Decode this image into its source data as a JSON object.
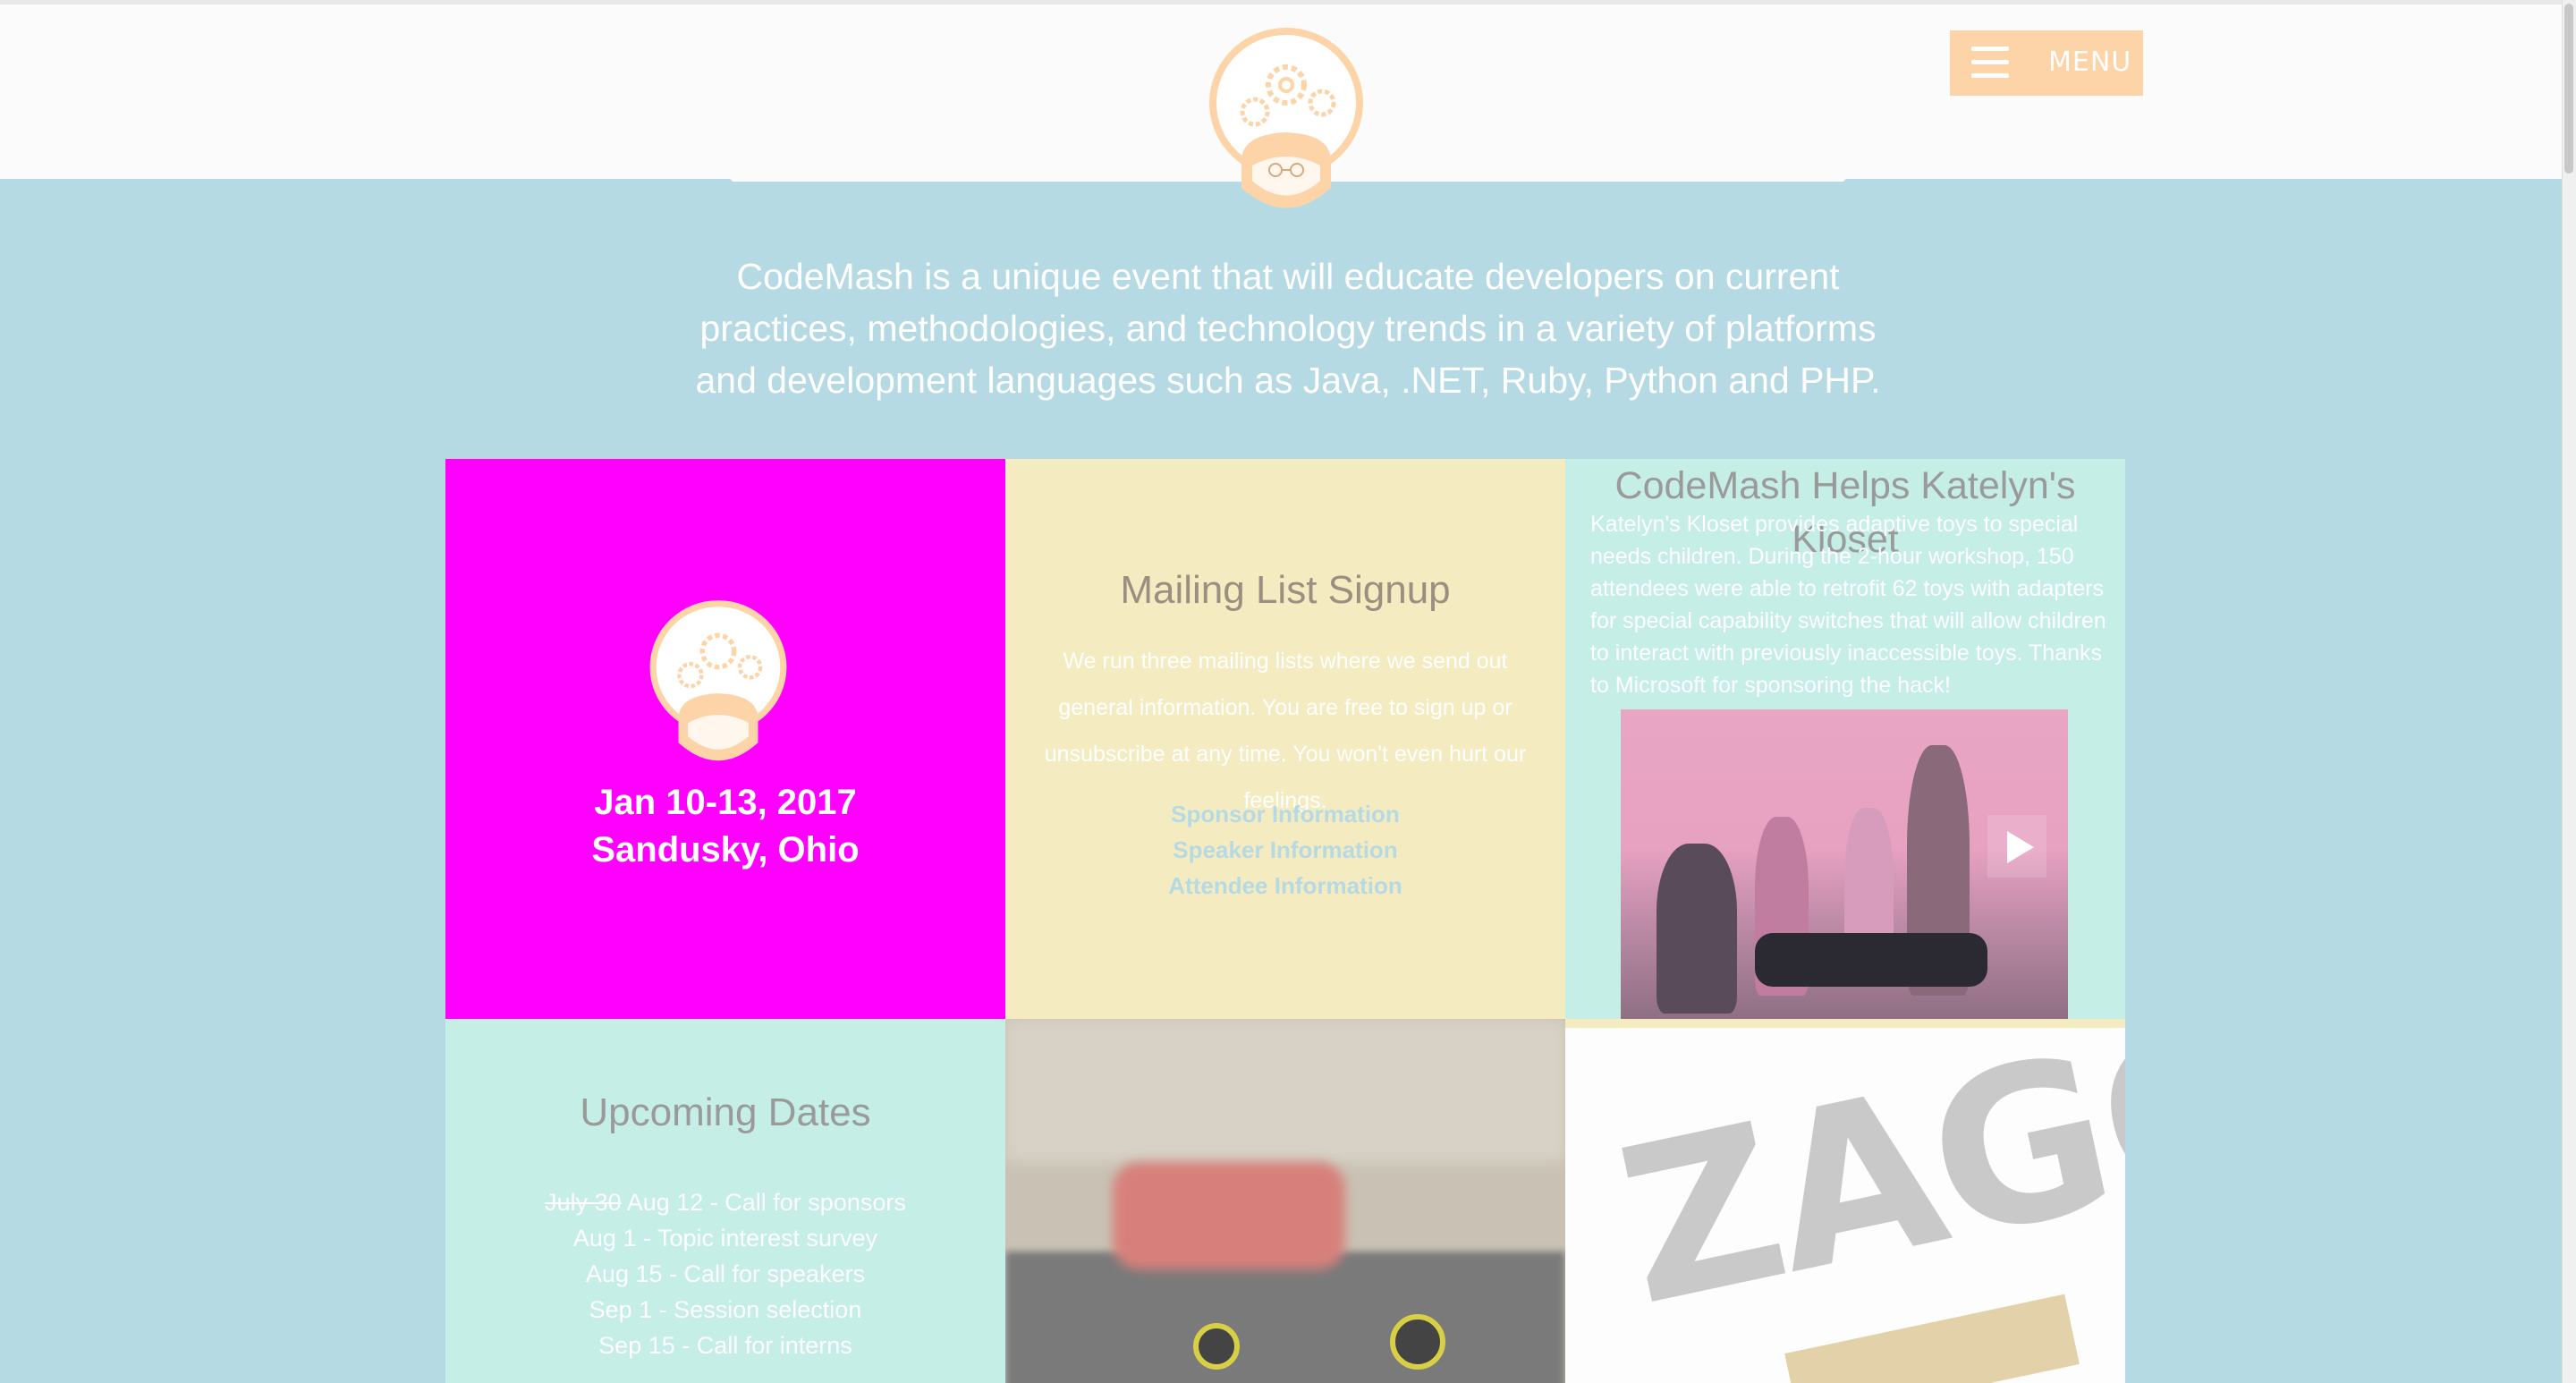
{
  "header": {
    "menu_label": "MENU",
    "accent_color": "#fcd4a7"
  },
  "intro": {
    "text": "CodeMash is a unique event that will educate developers on current practices, methodologies, and technology trends in a variety of platforms and development languages such as Java, .NET, Ruby, Python and PHP."
  },
  "event": {
    "dates": "Jan 10-13, 2017",
    "location": "Sandusky, Ohio"
  },
  "mailing": {
    "title": "Mailing List Signup",
    "text": "We run three mailing lists where we send out general information. You are free to sign up or unsubscribe at any time. You won't even hurt our feelings.",
    "links": [
      "Sponsor Information",
      "Speaker Information",
      "Attendee Information"
    ]
  },
  "news": {
    "title": "CodeMash Helps Katelyn's Kloset",
    "text": "Katelyn's Kloset provides adaptive toys to special needs children. During the 2-hour workshop, 150 attendees were able to retrofit 62 toys with adapters for special capability switches that will allow children to interact with previously inaccessible toys. Thanks to Microsoft for sponsoring the hack!"
  },
  "upcoming": {
    "title": "Upcoming Dates",
    "items": [
      {
        "strike": "July 30",
        "text": " Aug 12 - Call for sponsors"
      },
      {
        "strike": "",
        "text": "Aug 1 - Topic interest survey"
      },
      {
        "strike": "",
        "text": "Aug 15 - Call for speakers"
      },
      {
        "strike": "",
        "text": "Sep 1 - Session selection"
      },
      {
        "strike": "",
        "text": "Sep 15 - Call for interns"
      }
    ]
  },
  "sponsor": {
    "logo_text": "ZAGG"
  },
  "colors": {
    "page_bg": "#b5dae3",
    "magenta": "#ff00ff",
    "cream": "#f5ebc1",
    "mint": "#c5eee6"
  }
}
